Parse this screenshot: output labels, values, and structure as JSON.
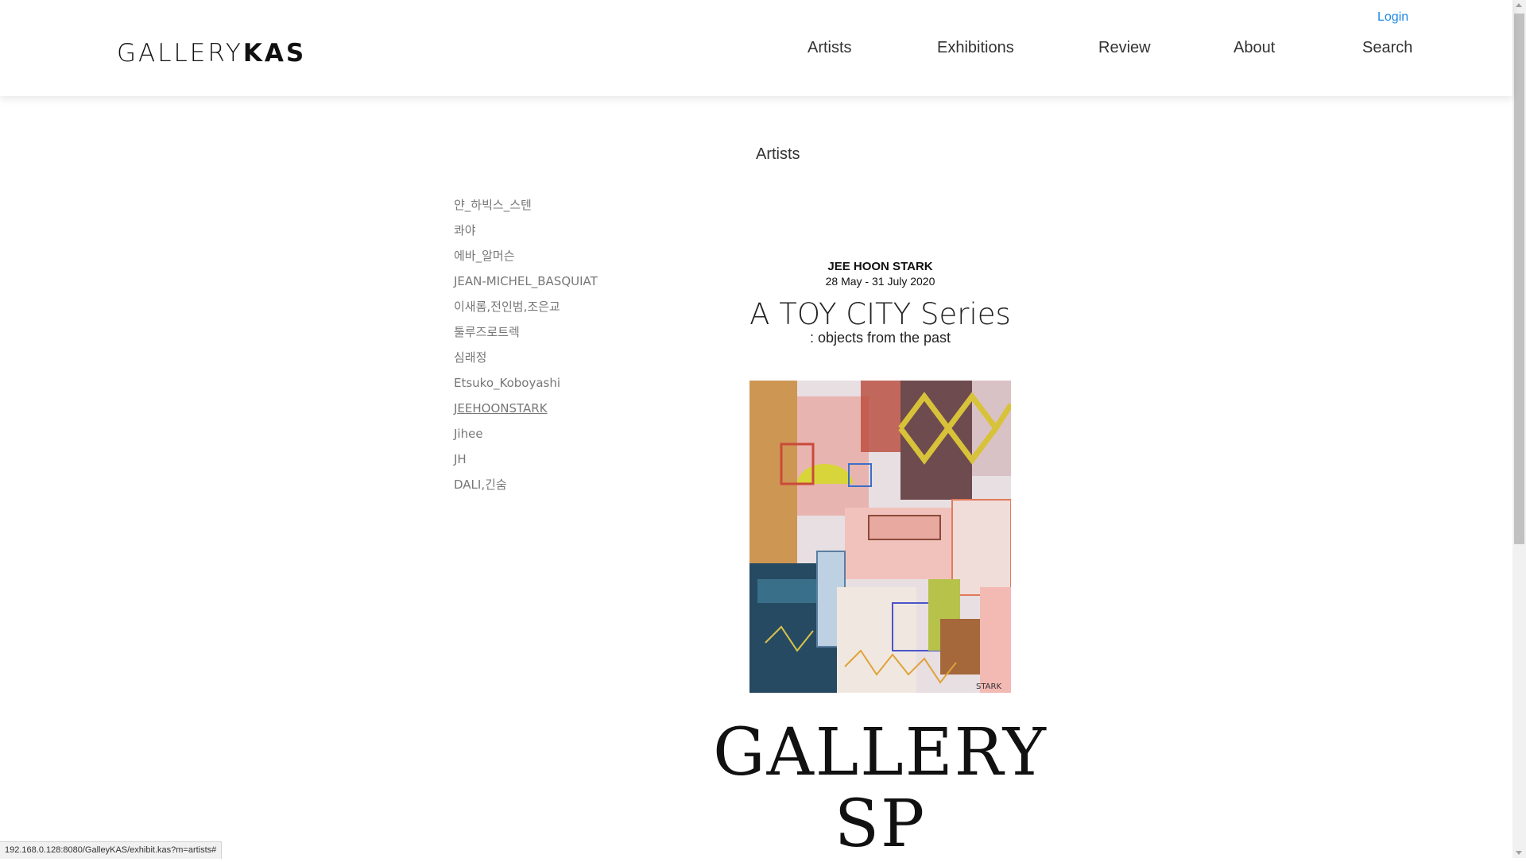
{
  "header": {
    "logo_light": "GALLERY",
    "logo_bold": "KAS",
    "login": "Login",
    "nav": [
      "Artists",
      "Exhibitions",
      "Review",
      "About",
      "Search"
    ]
  },
  "main": {
    "title": "Artists",
    "artists": [
      "얀_하빅스_스텐",
      "콰야",
      "에바_알머슨",
      "JEAN-MICHEL_BASQUIAT",
      "이새롬,전인범,조은교",
      "툴루즈로트렉",
      "심래정",
      "Etsuko_Koboyashi",
      "JEEHOONSTARK",
      "Jihee",
      "JH",
      "DALI,긴숨"
    ],
    "active_artist": "JEEHOONSTARK"
  },
  "poster": {
    "artist": "JEE HOON STARK",
    "dates": "28 May - 31 July 2020",
    "title": "A TOY CITY Series",
    "subtitle": ": objects from the past",
    "gallery": "GALLERY SP"
  },
  "status_bar": {
    "url": "192.168.0.128:8080/GalleyKAS/exhibit.kas?m=artists#"
  },
  "colors": {
    "login_link": "#1e88e5",
    "artist_link": "#777777",
    "text": "#333333"
  }
}
